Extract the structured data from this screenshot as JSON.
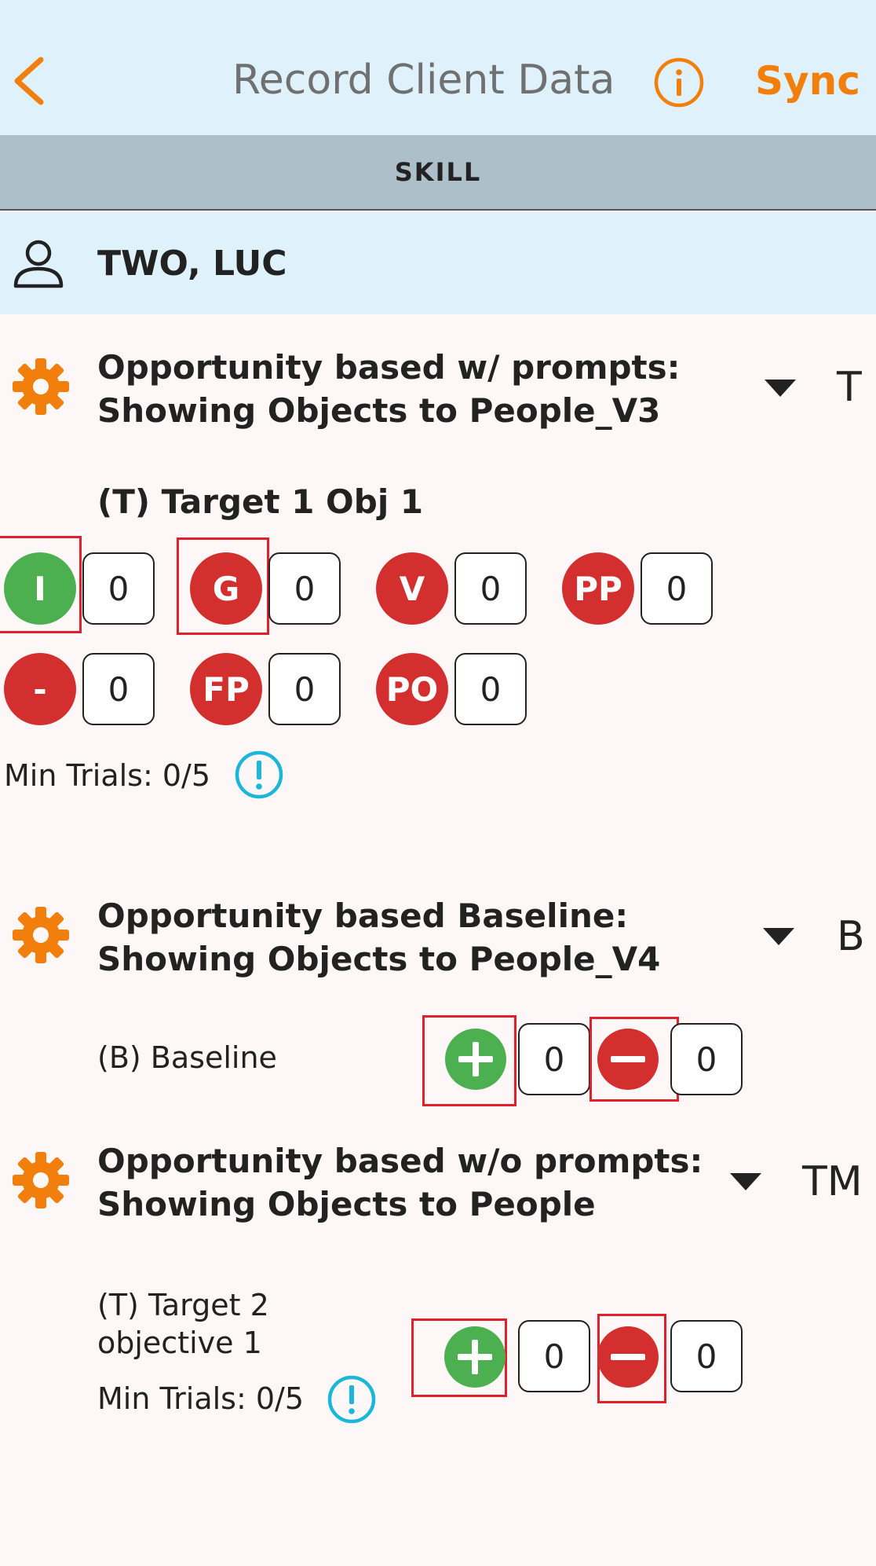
{
  "nav": {
    "title": "Record Client Data",
    "sync_label": "Sync"
  },
  "segment": {
    "label": "SKILL"
  },
  "client": {
    "name": "TWO, LUC"
  },
  "programs": [
    {
      "title_line1": "Opportunity based w/ prompts:",
      "title_line2": "Showing Objects to People_V3",
      "phase": "T",
      "target": "(T) Target 1 Obj 1",
      "prompts": [
        {
          "label": "I",
          "count": "0",
          "color": "#4caf50"
        },
        {
          "label": "G",
          "count": "0",
          "color": "#d32f2f"
        },
        {
          "label": "V",
          "count": "0",
          "color": "#d32f2f"
        },
        {
          "label": "PP",
          "count": "0",
          "color": "#d32f2f"
        },
        {
          "label": "-",
          "count": "0",
          "color": "#d32f2f"
        },
        {
          "label": "FP",
          "count": "0",
          "color": "#d32f2f"
        },
        {
          "label": "PO",
          "count": "0",
          "color": "#d32f2f"
        }
      ],
      "min_trials": "Min Trials: 0/5"
    },
    {
      "title_line1": "Opportunity based Baseline:",
      "title_line2": "Showing Objects to People_V4",
      "phase": "B",
      "target": "(B) Baseline",
      "plus_count": "0",
      "minus_count": "0"
    },
    {
      "title_line1": "Opportunity based w/o prompts:",
      "title_line2": "Showing Objects to People",
      "phase": "TM",
      "target_line1": "(T) Target 2",
      "target_line2": "objective 1",
      "min_trials": "Min Trials: 0/5",
      "plus_count": "0",
      "minus_count": "0"
    }
  ],
  "colors": {
    "accent": "#f27f0c",
    "positive": "#4caf50",
    "negative": "#d32f2f",
    "info": "#1bb6d8",
    "highlight": "#e0202a"
  },
  "icons": [
    "back-chevron-icon",
    "info-icon",
    "person-icon",
    "gear-icon",
    "caret-down-icon",
    "exclamation-icon",
    "plus-icon",
    "minus-icon"
  ]
}
